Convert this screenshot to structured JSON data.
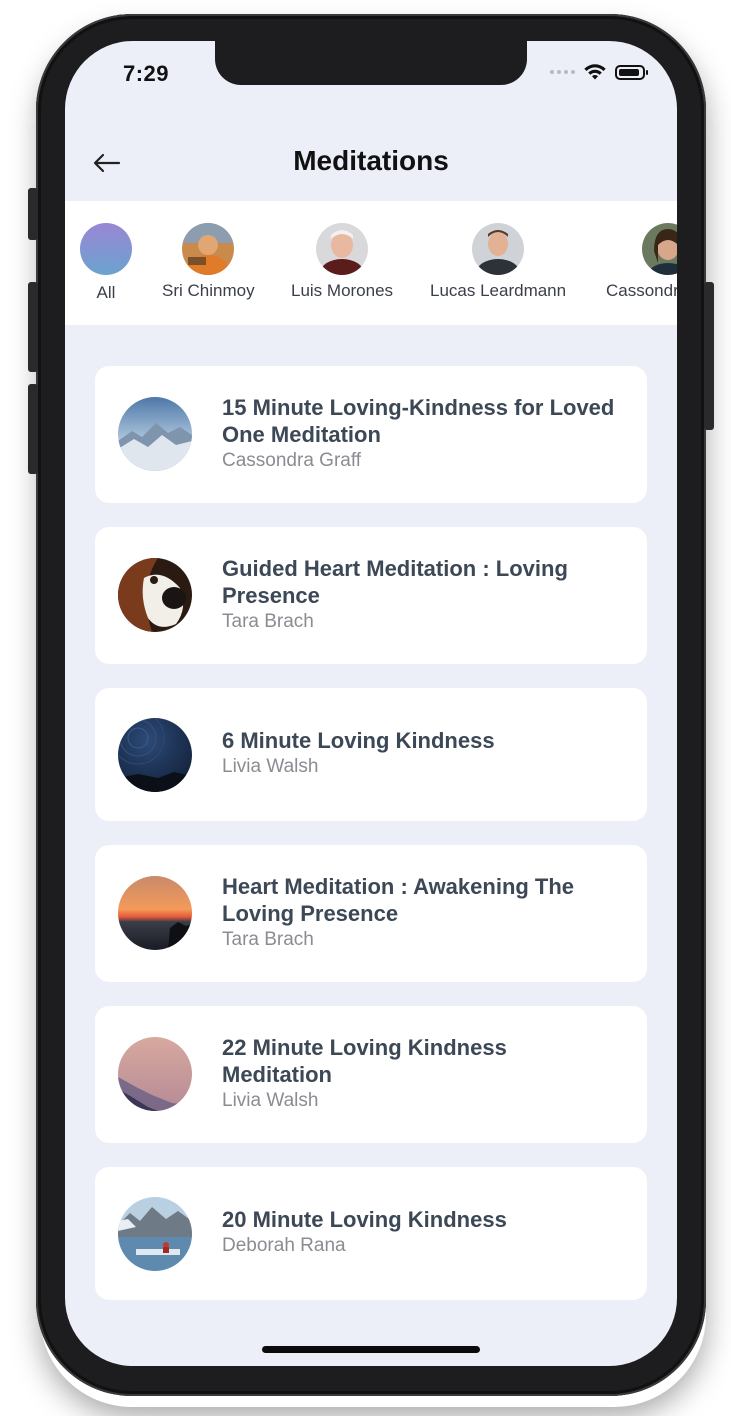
{
  "status": {
    "time": "7:29"
  },
  "header": {
    "title": "Meditations"
  },
  "authors": [
    {
      "label": "All"
    },
    {
      "label": "Sri Chinmoy"
    },
    {
      "label": "Luis Morones"
    },
    {
      "label": "Lucas Leardmann"
    },
    {
      "label": "Cassondra Graff"
    }
  ],
  "meditations": [
    {
      "title": "15 Minute Loving-Kindness for Loved One Meditation",
      "author": "Cassondra Graff"
    },
    {
      "title": "Guided Heart Meditation : Loving Presence",
      "author": "Tara Brach"
    },
    {
      "title": "6 Minute Loving Kindness",
      "author": "Livia Walsh"
    },
    {
      "title": "Heart Meditation : Awakening The Loving Presence",
      "author": "Tara Brach"
    },
    {
      "title": "22 Minute Loving Kindness Meditation",
      "author": "Livia Walsh"
    },
    {
      "title": "20 Minute Loving Kindness",
      "author": "Deborah Rana"
    }
  ],
  "colors": {
    "screen_bg": "#eceef8",
    "card_bg": "#ffffff",
    "title_text": "#3d4856",
    "subtitle_text": "#8a8c92"
  }
}
